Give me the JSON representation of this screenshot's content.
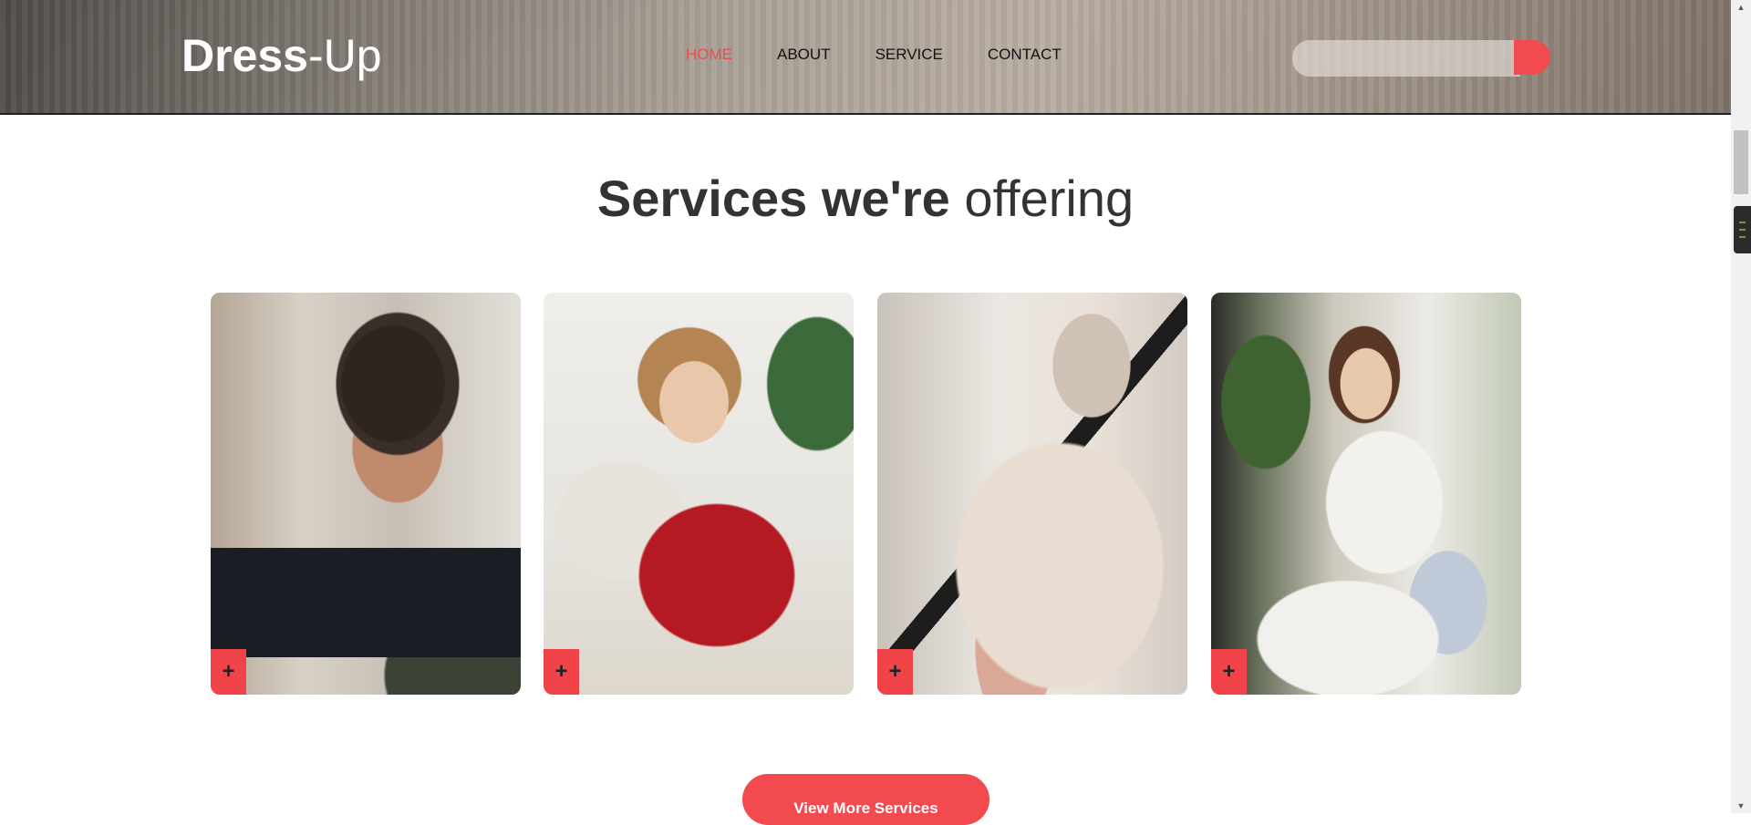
{
  "header": {
    "logo": {
      "bold": "Dress",
      "light": "-Up"
    },
    "nav": [
      "HOME",
      "ABOUT",
      "SERVICE",
      "CONTACT"
    ],
    "active_nav": "HOME",
    "search": {
      "placeholder": ""
    }
  },
  "section": {
    "title_bold": "Services we're",
    "title_light": "offering",
    "cards": [
      {
        "image": "tailor-measuring-woman",
        "plus": "+"
      },
      {
        "image": "woman-sewing-machine",
        "plus": "+"
      },
      {
        "image": "cutting-fabric-on-mannequin",
        "plus": "+"
      },
      {
        "image": "woman-hand-sewing",
        "plus": "+"
      }
    ],
    "button_label": "View More Services"
  },
  "colors": {
    "accent": "#f24b4f",
    "text_dark": "#333333",
    "nav_text": "#111111"
  }
}
